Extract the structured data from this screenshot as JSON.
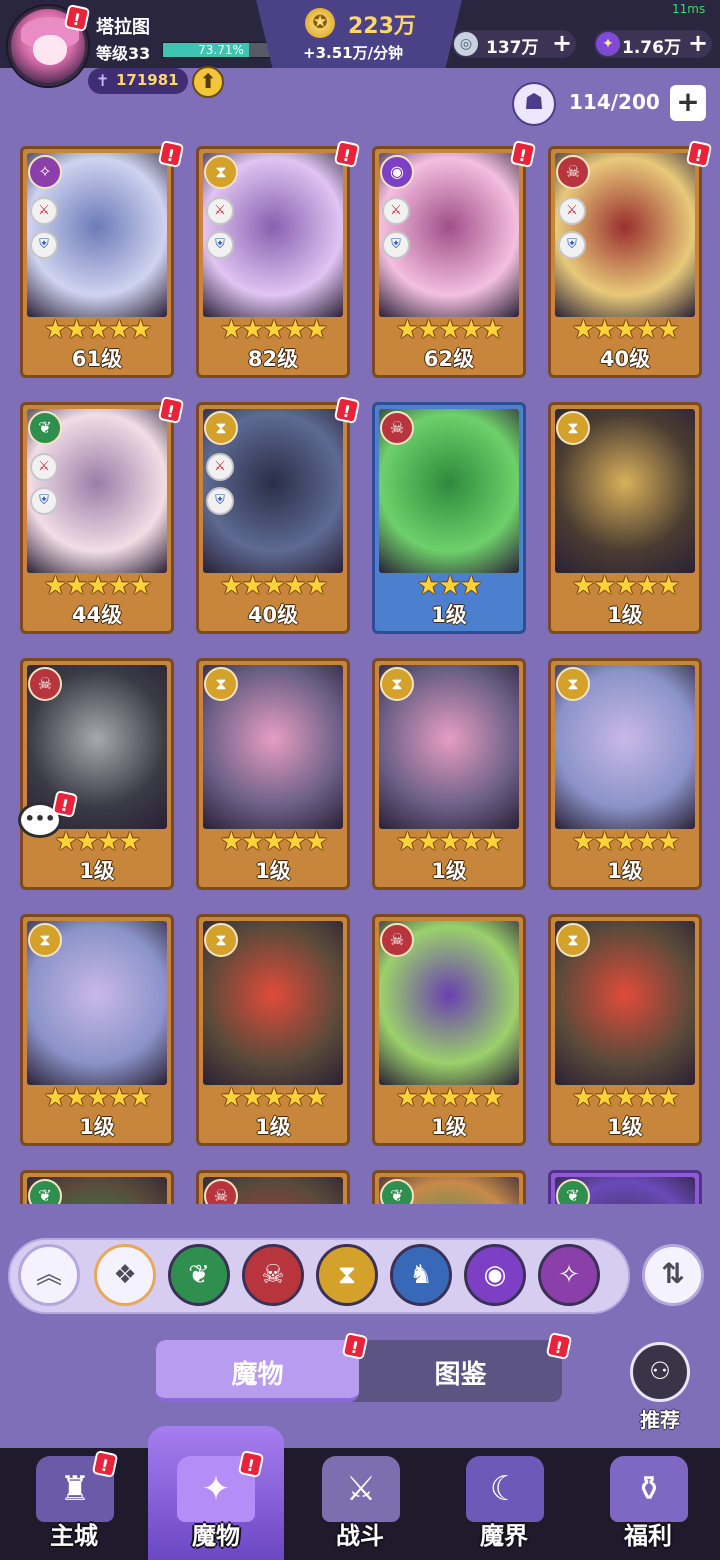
{
  "status": {
    "latency": "11ms"
  },
  "player": {
    "name": "塔拉图",
    "level": "等级33",
    "xp_percent": "73.71%",
    "xp_fraction": 0.7371,
    "power": "171981",
    "avatar_alert": "!"
  },
  "currency": {
    "gold": "223万",
    "gold_rate": "+3.51万/分钟",
    "gems": "137万",
    "crystals": "1.76万",
    "plus": "+"
  },
  "capacity": {
    "label": "114/200",
    "add": "+"
  },
  "monsters": [
    {
      "faction": "arcane",
      "stars": "★★★★★",
      "level": "61级",
      "alert": true,
      "buffs": true
    },
    {
      "faction": "time",
      "stars": "★★★★★",
      "level": "82级",
      "alert": true,
      "buffs": true
    },
    {
      "faction": "eye",
      "stars": "★★★★★",
      "level": "62级",
      "alert": true,
      "buffs": true
    },
    {
      "faction": "demon",
      "stars": "★★★★★",
      "level": "40级",
      "alert": true,
      "buffs": true
    },
    {
      "faction": "nature",
      "stars": "★★★★★",
      "level": "44级",
      "alert": true,
      "buffs": true
    },
    {
      "faction": "time",
      "stars": "★★★★★",
      "level": "40级",
      "alert": true,
      "buffs": true
    },
    {
      "faction": "demon",
      "stars": "★★★",
      "level": "1级",
      "alert": false,
      "buffs": false
    },
    {
      "faction": "time",
      "stars": "★★★★★",
      "level": "1级",
      "alert": false,
      "buffs": false
    },
    {
      "faction": "demon",
      "stars": "★★★★",
      "level": "1级",
      "alert": false,
      "buffs": false
    },
    {
      "faction": "time",
      "stars": "★★★★★",
      "level": "1级",
      "alert": false,
      "buffs": false
    },
    {
      "faction": "time",
      "stars": "★★★★★",
      "level": "1级",
      "alert": false,
      "buffs": false
    },
    {
      "faction": "time",
      "stars": "★★★★★",
      "level": "1级",
      "alert": false,
      "buffs": false
    },
    {
      "faction": "time",
      "stars": "★★★★★",
      "level": "1级",
      "alert": false,
      "buffs": false
    },
    {
      "faction": "time",
      "stars": "★★★★★",
      "level": "1级",
      "alert": false,
      "buffs": false
    },
    {
      "faction": "demon",
      "stars": "★★★★★",
      "level": "1级",
      "alert": false,
      "buffs": false
    },
    {
      "faction": "time",
      "stars": "★★★★★",
      "level": "1级",
      "alert": false,
      "buffs": false
    },
    {
      "faction": "nature",
      "stars": "",
      "level": "",
      "alert": false,
      "buffs": false
    },
    {
      "faction": "demon",
      "stars": "",
      "level": "",
      "alert": false,
      "buffs": false
    },
    {
      "faction": "nature",
      "stars": "",
      "level": "",
      "alert": false,
      "buffs": false
    },
    {
      "faction": "nature",
      "stars": "",
      "level": "",
      "alert": false,
      "buffs": false
    }
  ],
  "filters": [
    "collapse",
    "all",
    "nature",
    "demon",
    "time",
    "beast",
    "eye",
    "arcane"
  ],
  "tabs": {
    "monsters": "魔物",
    "codex": "图鉴"
  },
  "recommend": {
    "label": "推荐"
  },
  "nav": [
    {
      "id": "main-city",
      "label": "主城"
    },
    {
      "id": "monsters",
      "label": "魔物"
    },
    {
      "id": "battle",
      "label": "战斗"
    },
    {
      "id": "demon-realm",
      "label": "魔界"
    },
    {
      "id": "welfare",
      "label": "福利"
    }
  ],
  "colors": {
    "background": "#7f6eb8",
    "gold": "#ffd66b",
    "star": "#ffd23b",
    "alert": "#e8233b",
    "accent": "#b79cf0"
  }
}
